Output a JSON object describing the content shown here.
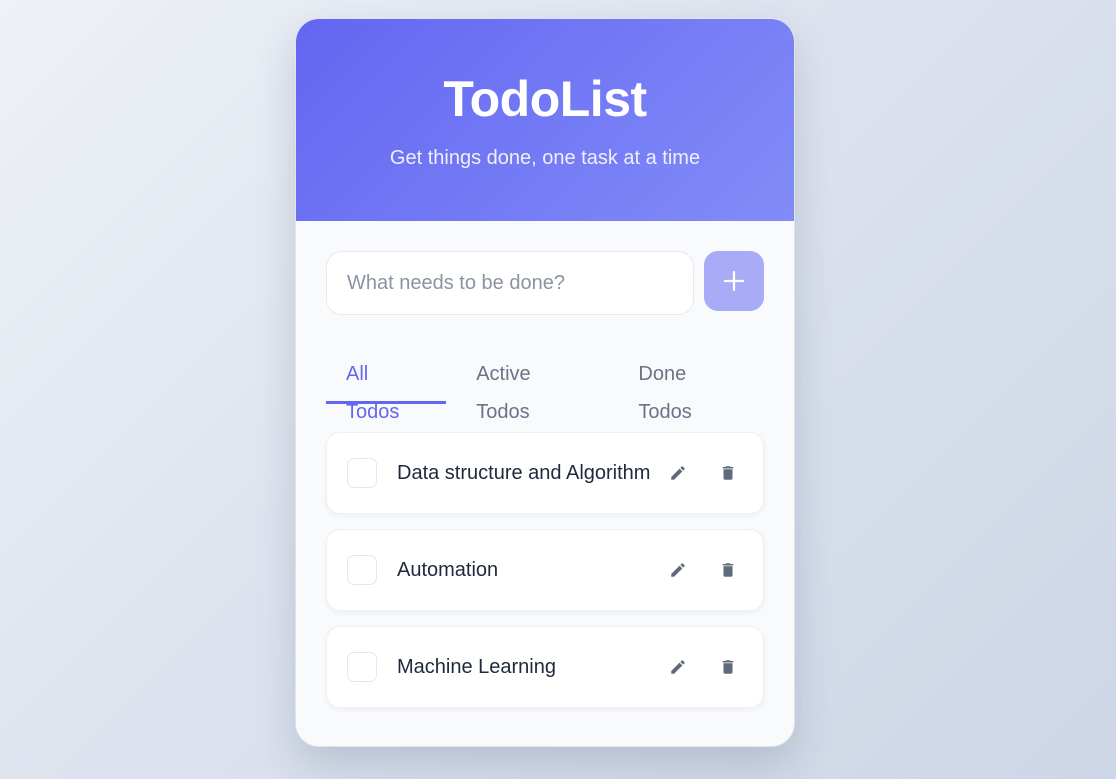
{
  "header": {
    "title": "TodoList",
    "subtitle": "Get things done, one task at a time"
  },
  "add": {
    "placeholder": "What needs to be done?",
    "value": "",
    "button_icon": "plus-icon"
  },
  "tabs": [
    {
      "label": "All Todos",
      "active": true
    },
    {
      "label": "Active Todos",
      "active": false
    },
    {
      "label": "Done Todos",
      "active": false
    }
  ],
  "todos": [
    {
      "text": "Data structure and Algorithm",
      "done": false
    },
    {
      "text": "Automation",
      "done": false
    },
    {
      "text": "Machine Learning",
      "done": false
    }
  ],
  "icons": {
    "edit": "pencil-icon",
    "delete": "trash-icon"
  },
  "colors": {
    "accent": "#6366f1",
    "header_gradient_end": "#828cf8",
    "add_button": "#a8abf5",
    "icon": "#5f6b7c"
  }
}
